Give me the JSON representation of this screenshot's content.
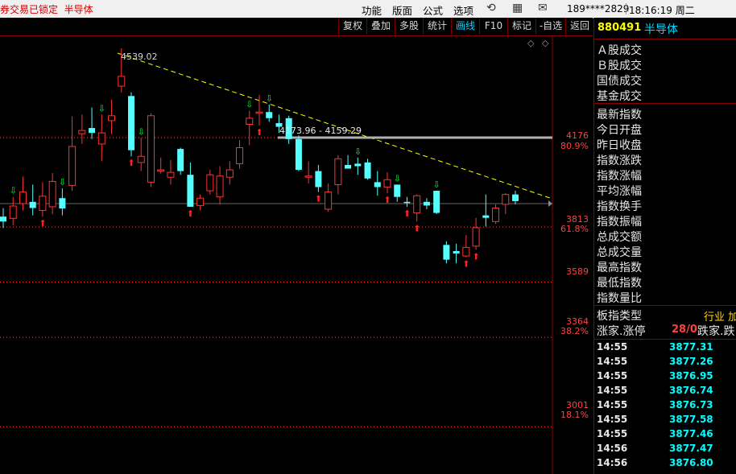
{
  "titlebar": {
    "lock_text": "券交易已锁定",
    "sector_text": "半导体",
    "menus": [
      "功能",
      "版面",
      "公式",
      "选项"
    ],
    "account": "189****2829",
    "clock": "18:16:19 周二"
  },
  "toolbar": {
    "buttons": [
      "复权",
      "叠加",
      "多股",
      "统计",
      "画线",
      "F10",
      "标记",
      "-自选",
      "返回"
    ],
    "active": "画线"
  },
  "chart": {
    "price_labels": [
      "4176",
      "80.9%",
      "3813",
      "61.8%",
      "3589",
      "3364",
      "38.2%",
      "3001",
      "18.1%"
    ],
    "peak_label": "4539.02",
    "range_label": "4173.96 - 4159.29",
    "colors": {
      "up": "#ff3232",
      "down": "#54ffff",
      "trend": "#ffff00",
      "fib": "#ff4040",
      "hline": "#c8c8c8"
    }
  },
  "chart_data": {
    "type": "candlestick",
    "title": "",
    "ylim": [
      2950,
      4600
    ],
    "reference_levels": [
      {
        "value": 4176,
        "pct": "80.9%"
      },
      {
        "value": 3813,
        "pct": "61.8%"
      },
      {
        "value": 3589,
        "pct": ""
      },
      {
        "value": 3364,
        "pct": "38.2%"
      },
      {
        "value": 3001,
        "pct": "18.1%"
      }
    ],
    "annotations": [
      {
        "label": "4539.02",
        "value": 4539.02
      },
      {
        "label": "4173.96 - 4159.29",
        "value": 4166
      }
    ],
    "candles": [
      {
        "o": 3855,
        "c": 3835,
        "h": 3890,
        "l": 3808
      },
      {
        "o": 3848,
        "c": 3898,
        "h": 3935,
        "l": 3820
      },
      {
        "o": 3908,
        "c": 3955,
        "h": 4018,
        "l": 3880
      },
      {
        "o": 3915,
        "c": 3890,
        "h": 3985,
        "l": 3860
      },
      {
        "o": 3880,
        "c": 3938,
        "h": 3995,
        "l": 3855
      },
      {
        "o": 3895,
        "c": 3998,
        "h": 4032,
        "l": 3865
      },
      {
        "o": 3930,
        "c": 3888,
        "h": 3970,
        "l": 3860
      },
      {
        "o": 3982,
        "c": 4140,
        "h": 4262,
        "l": 3960
      },
      {
        "o": 4192,
        "c": 4205,
        "h": 4270,
        "l": 4150
      },
      {
        "o": 4215,
        "c": 4195,
        "h": 4298,
        "l": 4170
      },
      {
        "o": 4150,
        "c": 4195,
        "h": 4270,
        "l": 4080
      },
      {
        "o": 4245,
        "c": 4265,
        "h": 4330,
        "l": 4190
      },
      {
        "o": 4385,
        "c": 4425,
        "h": 4539,
        "l": 4360
      },
      {
        "o": 4345,
        "c": 4125,
        "h": 4360,
        "l": 4100
      },
      {
        "o": 4075,
        "c": 4100,
        "h": 4175,
        "l": 4040
      },
      {
        "o": 3995,
        "c": 4265,
        "h": 4275,
        "l": 3975
      },
      {
        "o": 4040,
        "c": 4045,
        "h": 4095,
        "l": 4030
      },
      {
        "o": 4015,
        "c": 4035,
        "h": 4085,
        "l": 3985
      },
      {
        "o": 4130,
        "c": 4040,
        "h": 4135,
        "l": 4025
      },
      {
        "o": 4025,
        "c": 3895,
        "h": 4075,
        "l": 3895
      },
      {
        "o": 3900,
        "c": 3930,
        "h": 3945,
        "l": 3880
      },
      {
        "o": 3960,
        "c": 4025,
        "h": 4045,
        "l": 3945
      },
      {
        "o": 3935,
        "c": 4020,
        "h": 4060,
        "l": 3905
      },
      {
        "o": 4015,
        "c": 4045,
        "h": 4080,
        "l": 3985
      },
      {
        "o": 4070,
        "c": 4135,
        "h": 4165,
        "l": 4050
      },
      {
        "o": 4230,
        "c": 4255,
        "h": 4285,
        "l": 4145
      },
      {
        "o": 4275,
        "c": 4280,
        "h": 4350,
        "l": 4225
      },
      {
        "o": 4280,
        "c": 4255,
        "h": 4310,
        "l": 4240
      },
      {
        "o": 4235,
        "c": 4220,
        "h": 4270,
        "l": 4195
      },
      {
        "o": 4255,
        "c": 4170,
        "h": 4265,
        "l": 4150
      },
      {
        "o": 4170,
        "c": 4045,
        "h": 4185,
        "l": 4040
      },
      {
        "o": 4015,
        "c": 4020,
        "h": 4080,
        "l": 3990
      },
      {
        "o": 4040,
        "c": 3975,
        "h": 4065,
        "l": 3955
      },
      {
        "o": 3885,
        "c": 3955,
        "h": 3990,
        "l": 3875
      },
      {
        "o": 3985,
        "c": 4090,
        "h": 4105,
        "l": 3945
      },
      {
        "o": 4065,
        "c": 4050,
        "h": 4105,
        "l": 4050
      },
      {
        "o": 4070,
        "c": 4060,
        "h": 4095,
        "l": 4025
      },
      {
        "o": 4075,
        "c": 4010,
        "h": 4090,
        "l": 4005
      },
      {
        "o": 3995,
        "c": 3975,
        "h": 4040,
        "l": 3940
      },
      {
        "o": 3975,
        "c": 4005,
        "h": 4035,
        "l": 3950
      },
      {
        "o": 3985,
        "c": 3935,
        "h": 3985,
        "l": 3915
      },
      {
        "o": 3915,
        "c": 3910,
        "h": 3935,
        "l": 3895
      },
      {
        "o": 3870,
        "c": 3940,
        "h": 3945,
        "l": 3835
      },
      {
        "o": 3915,
        "c": 3900,
        "h": 3930,
        "l": 3885
      },
      {
        "o": 3960,
        "c": 3870,
        "h": 3960,
        "l": 3865
      },
      {
        "o": 3740,
        "c": 3680,
        "h": 3755,
        "l": 3665
      },
      {
        "o": 3715,
        "c": 3705,
        "h": 3745,
        "l": 3665
      },
      {
        "o": 3695,
        "c": 3730,
        "h": 3780,
        "l": 3690
      },
      {
        "o": 3735,
        "c": 3810,
        "h": 3850,
        "l": 3720
      },
      {
        "o": 3860,
        "c": 3850,
        "h": 3945,
        "l": 3815
      },
      {
        "o": 3835,
        "c": 3890,
        "h": 3905,
        "l": 3825
      },
      {
        "o": 3905,
        "c": 3945,
        "h": 3950,
        "l": 3865
      },
      {
        "o": 3945,
        "c": 3918,
        "h": 3960,
        "l": 3905
      }
    ]
  },
  "panel": {
    "code": "880491",
    "name": "半导体",
    "labels_a": [
      "Ａ股成交",
      "Ｂ股成交",
      "国债成交",
      "基金成交"
    ],
    "labels_b": [
      "最新指数",
      "今日开盘",
      "昨日收盘",
      "指数涨跌",
      "指数涨幅",
      "平均涨幅",
      "指数换手",
      "指数振幅",
      "总成交额",
      "总成交量",
      "最高指数",
      "最低指数",
      "指数量比"
    ],
    "type_label": "板指类型",
    "type_value": "行业 加",
    "updown_label": "涨家.涨停",
    "updown_value": "28/0",
    "updown_label2": "跌家.跌",
    "ticks": [
      {
        "time": "14:55",
        "price": "3877.31"
      },
      {
        "time": "14:55",
        "price": "3877.26"
      },
      {
        "time": "14:55",
        "price": "3876.95"
      },
      {
        "time": "14:55",
        "price": "3876.74"
      },
      {
        "time": "14:55",
        "price": "3876.73"
      },
      {
        "time": "14:55",
        "price": "3877.58"
      },
      {
        "time": "14:55",
        "price": "3877.46"
      },
      {
        "time": "14:56",
        "price": "3877.47"
      },
      {
        "time": "14:56",
        "price": "3876.80"
      }
    ]
  }
}
